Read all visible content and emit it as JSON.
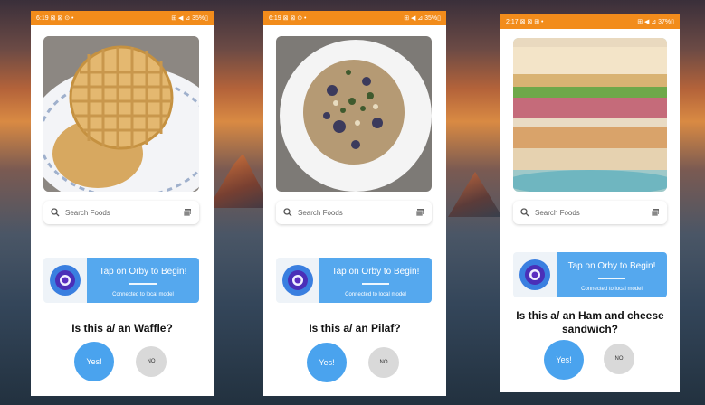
{
  "phones": [
    {
      "status": {
        "time": "6:19",
        "left_icons": "⊠ ⊠ ⊙ •",
        "right_icons": "⊞ ◀ ⊿ 35%▯"
      },
      "search": {
        "placeholder": "Search Foods"
      },
      "orby": {
        "tap_label": "Tap on Orby to Begin!",
        "connection": "Connected to local model"
      },
      "question": "Is this a/ an Waffle?",
      "yes_label": "Yes!",
      "no_label": "NO",
      "food_icon": "waffle-photo"
    },
    {
      "status": {
        "time": "6:19",
        "left_icons": "⊠ ⊠ ⊙ •",
        "right_icons": "⊞ ◀ ⊿ 35%▯"
      },
      "search": {
        "placeholder": "Search Foods"
      },
      "orby": {
        "tap_label": "Tap on Orby to Begin!",
        "connection": "Connected to local model"
      },
      "question": "Is this a/ an Pilaf?",
      "yes_label": "Yes!",
      "no_label": "NO",
      "food_icon": "pilaf-photo"
    },
    {
      "status": {
        "time": "2:17",
        "left_icons": "⊠ ⊠ ⊞ •",
        "right_icons": "⊞ ◀ ⊿ 37%▯"
      },
      "search": {
        "placeholder": "Search Foods"
      },
      "orby": {
        "tap_label": "Tap on Orby to Begin!",
        "connection": "Connected to local model"
      },
      "question": "Is this a/ an Ham and cheese sandwich?",
      "yes_label": "Yes!",
      "no_label": "NO",
      "food_icon": "sandwich-photo"
    }
  ],
  "colors": {
    "status_bar": "#f28c1b",
    "accent_blue": "#55a8ee",
    "yes_button": "#4aa3ee",
    "no_button": "#d9d9d9"
  }
}
